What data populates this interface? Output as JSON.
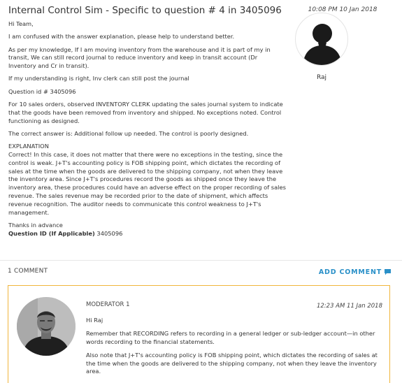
{
  "post": {
    "title": "Internal Control Sim - Specific to question # 4 in 3405096",
    "timestamp": "10:08 PM 10 Jan 2018",
    "author": {
      "name": "Raj",
      "avatar_icon": "default-user-silhouette-icon"
    },
    "paragraphs": [
      "Hi Team,",
      "I am confused with the answer explanation, please help to understand better.",
      "As per my knowledge, If I am moving inventory from the warehouse and it is part of my in transit, We can still record journal to reduce inventory and keep in transit account (Dr Inventory and Cr in transit).",
      "If my understanding is right, Inv clerk can still post the journal",
      "Question id # 3405096",
      "For 10 sales orders, observed INVENTORY CLERK updating the sales journal system to indicate that the goods have been removed from inventory and shipped. No exceptions noted. Control functioning as designed.",
      "The correct answer is: Additional follow up needed. The control is poorly designed."
    ],
    "explanation_heading": "EXPLANATION",
    "explanation": "Correct! In this case, it does not matter that there were no exceptions in the testing, since the control is weak. J+T's accounting policy is FOB shipping point, which dictates the recording of sales at the time when the goods are delivered to the shipping company, not when they leave the inventory area. Since J+T's procedures record the goods as shipped once they leave the inventory area, these procedures could have an adverse effect on the proper recording of sales revenue. The sales revenue may be recorded prior to the date of shipment, which affects revenue recognition. The auditor needs to communicate this control weakness to J+T's management.",
    "closing": "Thanks in advance",
    "question_id_label": "Question ID (If Applicable)",
    "question_id_value": "3405096"
  },
  "comments_bar": {
    "count_label": "1 COMMENT",
    "add_comment_label": "ADD COMMENT",
    "add_comment_icon": "speech-bubble-icon",
    "accent_color": "#2a90c8"
  },
  "comment": {
    "author": "MODERATOR 1",
    "timestamp": "12:23 AM 11 Jan 2018",
    "border_color": "#f0b53c",
    "paragraphs": [
      "Hi Raj",
      "Remember that RECORDING refers to recording in a general ledger or sub-ledger account—in other words recording to the financial statements.",
      "Also note that J+T's accounting policy is FOB shipping point, which dictates the recording of sales at the time when the goods are delivered to the shipping company, not when they leave the inventory area."
    ]
  }
}
